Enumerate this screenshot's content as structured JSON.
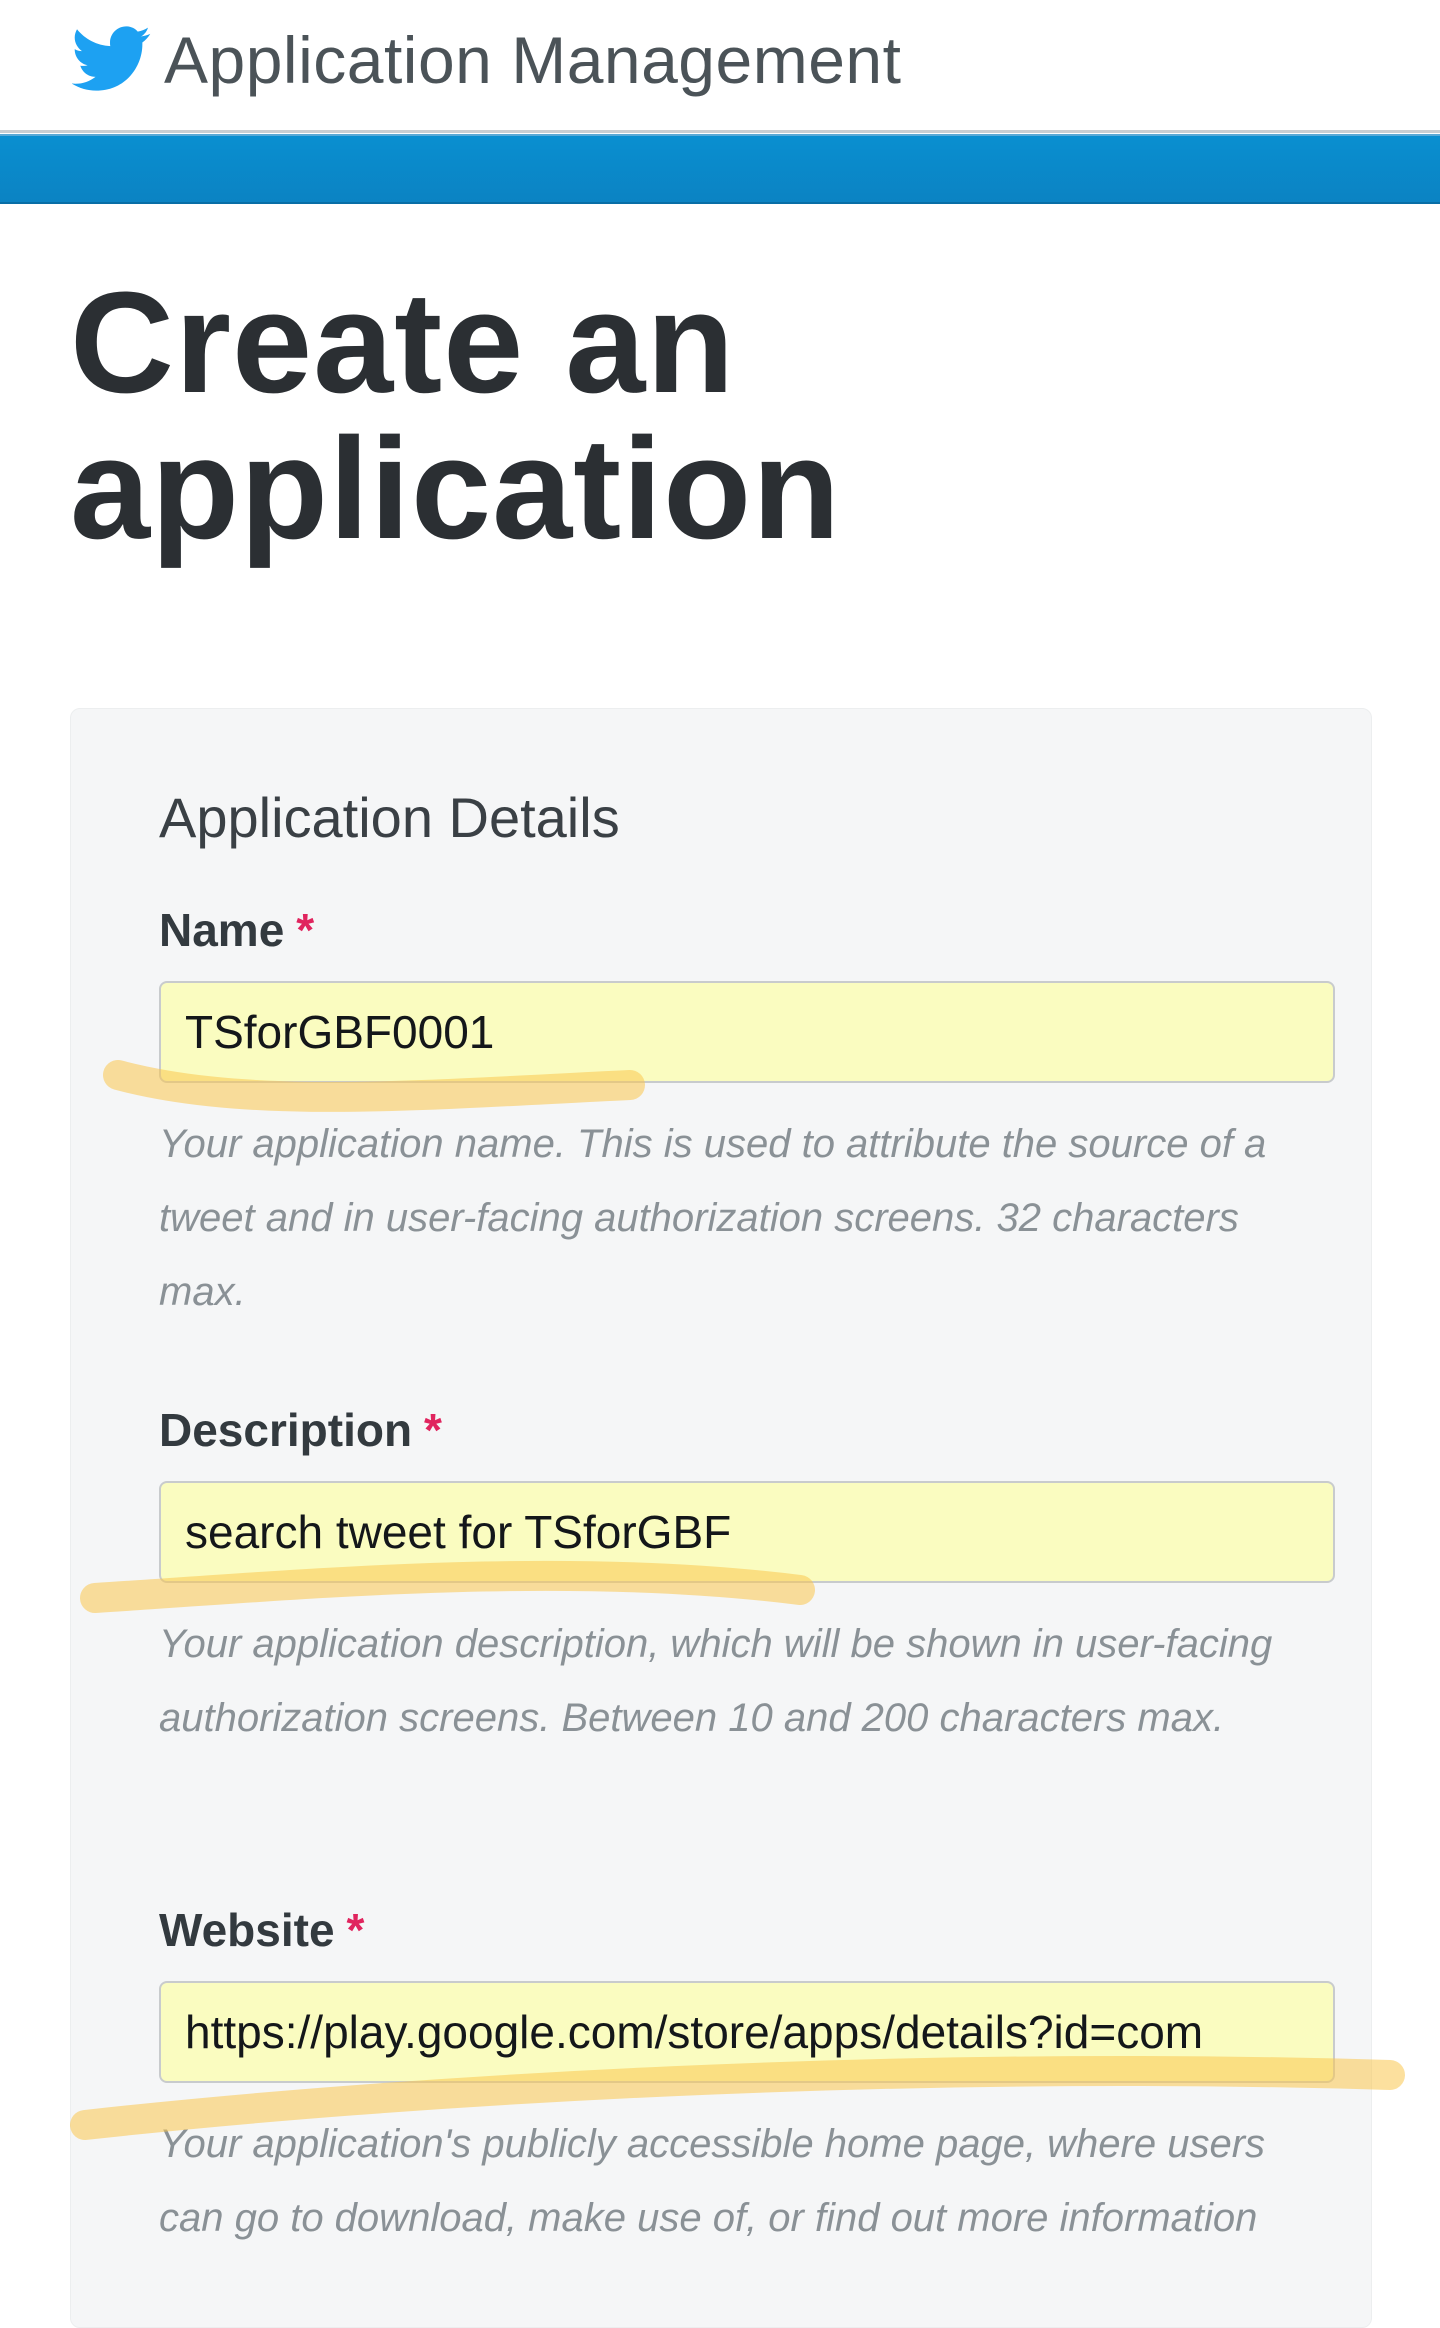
{
  "header": {
    "logo_icon": "twitter-bird-icon",
    "title": "Application Management",
    "brand_color": "#1da1f2",
    "band_color": "#0b88c9"
  },
  "page": {
    "title": "Create an application"
  },
  "panel": {
    "heading": "Application Details",
    "fields": [
      {
        "label": "Name",
        "required_mark": "*",
        "value": "TSforGBF0001",
        "help": "Your application name. This is used to attribute the source of a tweet and in user-facing authorization screens. 32 characters max."
      },
      {
        "label": "Description",
        "required_mark": "*",
        "value": "search tweet for TSforGBF",
        "help": "Your application description, which will be shown in user-facing authorization screens. Between 10 and 200 characters max."
      },
      {
        "label": "Website",
        "required_mark": "*",
        "value": "https://play.google.com/store/apps/details?id=com",
        "help": "Your application's publicly accessible home page, where users can go to download, make use of, or find out more information"
      }
    ]
  },
  "annotation": {
    "highlighter_color": "#f9c74f"
  }
}
